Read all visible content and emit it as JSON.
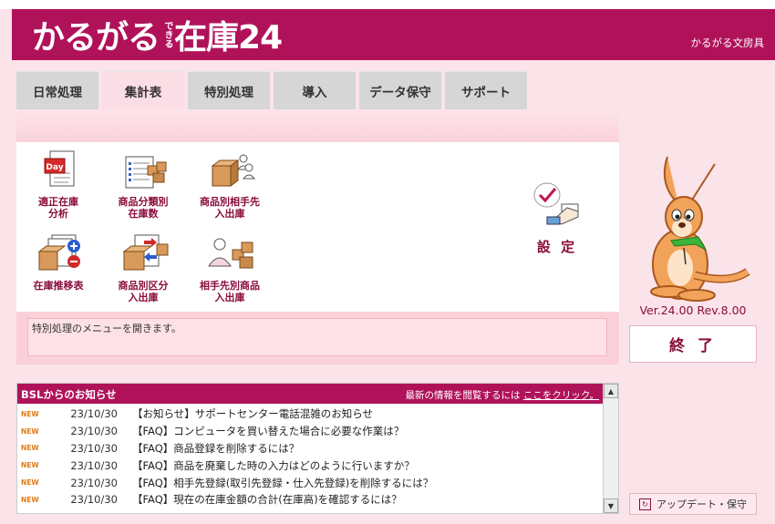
{
  "app": {
    "logo_main": "かるがる",
    "logo_small": "できる",
    "logo_tail": "在庫24",
    "company": "かるがる文房具"
  },
  "tabs": [
    {
      "label": "日常処理",
      "active": false
    },
    {
      "label": "集計表",
      "active": true
    },
    {
      "label": "特別処理",
      "active": false
    },
    {
      "label": "導入",
      "active": false
    },
    {
      "label": "データ保守",
      "active": false
    },
    {
      "label": "サポート",
      "active": false
    }
  ],
  "menu": {
    "items": [
      {
        "label_1": "適正在庫",
        "label_2": "分析",
        "icon": "calendar-day-icon"
      },
      {
        "label_1": "商品分類別",
        "label_2": "在庫数",
        "icon": "list-boxes-icon"
      },
      {
        "label_1": "商品別相手先",
        "label_2": "入出庫",
        "icon": "boxes-people-icon"
      },
      {
        "label_1": "在庫推移表",
        "label_2": "",
        "icon": "inventory-plus-minus-icon"
      },
      {
        "label_1": "商品別区分",
        "label_2": "入出庫",
        "icon": "box-transfer-icon"
      },
      {
        "label_1": "相手先別商品",
        "label_2": "入出庫",
        "icon": "person-boxes-icon"
      }
    ],
    "settings_label": "設 定",
    "day_text": "Day"
  },
  "status_text": "特別処理のメニューを開きます。",
  "version": "Ver.24.00 Rev.8.00",
  "exit_label": "終 了",
  "news": {
    "title": "BSLからのお知らせ",
    "link_prefix": "最新の情報を閲覧するには ",
    "link_text": "ここをクリック。",
    "new_badge": "NEW",
    "items": [
      {
        "date": "23/10/30",
        "text": "【お知らせ】サポートセンター電話混雑のお知らせ"
      },
      {
        "date": "23/10/30",
        "text": "【FAQ】コンピュータを買い替えた場合に必要な作業は？"
      },
      {
        "date": "23/10/30",
        "text": "【FAQ】商品登録を削除するには？"
      },
      {
        "date": "23/10/30",
        "text": "【FAQ】商品を廃棄した時の入力はどのように行いますか？"
      },
      {
        "date": "23/10/30",
        "text": "【FAQ】相手先登録(取引先登録・仕入先登録)を削除するには？"
      },
      {
        "date": "23/10/30",
        "text": "【FAQ】現在の在庫金額の合計(在庫高)を確認するには？"
      }
    ]
  },
  "update_label": "アップデート・保守",
  "colors": {
    "brand": "#b0125a",
    "accent_text": "#8a0d3c",
    "background": "#fbe3ea"
  }
}
